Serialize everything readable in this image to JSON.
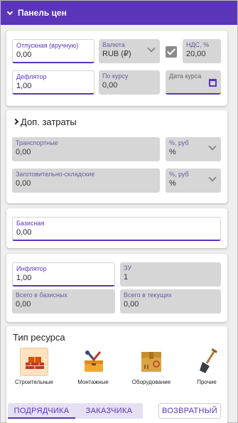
{
  "header": {
    "title": "Панель цен"
  },
  "top": {
    "retail": {
      "label": "Отпускная (вручную)",
      "value": "0,00"
    },
    "currency": {
      "label": "Валюта",
      "value": "RUB (₽)"
    },
    "vat": {
      "label": "НДС, %",
      "value": "20,00"
    },
    "deflator": {
      "label": "Дефлятор",
      "value": "1,00"
    },
    "by_rate": {
      "label": "По курсу",
      "value": "0,00"
    },
    "rate_date": {
      "label": "Дата курса",
      "value": ""
    }
  },
  "extra_costs": {
    "title": "Доп. затраты",
    "transport": {
      "label": "Транспортные",
      "value": "0,00"
    },
    "transport_unit": {
      "label": "%, руб",
      "value": "%"
    },
    "storage": {
      "label": "Заготовительно-складские",
      "value": "0,00"
    },
    "storage_unit": {
      "label": "%, руб",
      "value": "%"
    }
  },
  "base": {
    "label": "Базисная",
    "value": "0,00"
  },
  "indices": {
    "inflator": {
      "label": "Инфлятор",
      "value": "1,00"
    },
    "zu": {
      "label": "ЗУ",
      "value": "1"
    },
    "total_base": {
      "label": "Всего в базисных",
      "value": "0,00"
    },
    "total_current": {
      "label": "Всего в текущих",
      "value": "0,00"
    }
  },
  "resource_type": {
    "title": "Тип ресурса",
    "items": [
      {
        "label": "Строительные",
        "icon": "bricks-icon",
        "selected": true
      },
      {
        "label": "Монтажные",
        "icon": "toolbox-icon",
        "selected": false
      },
      {
        "label": "Оборудование",
        "icon": "box-icon",
        "selected": false
      },
      {
        "label": "Прочие",
        "icon": "shovel-icon",
        "selected": false
      }
    ]
  },
  "tabs": {
    "contractor": "ПОДРЯДЧИКА",
    "customer": "ЗАКАЗЧИКА"
  },
  "return_button": "ВОЗВРАТНЫЙ",
  "colors": {
    "accent": "#5a35b8"
  }
}
